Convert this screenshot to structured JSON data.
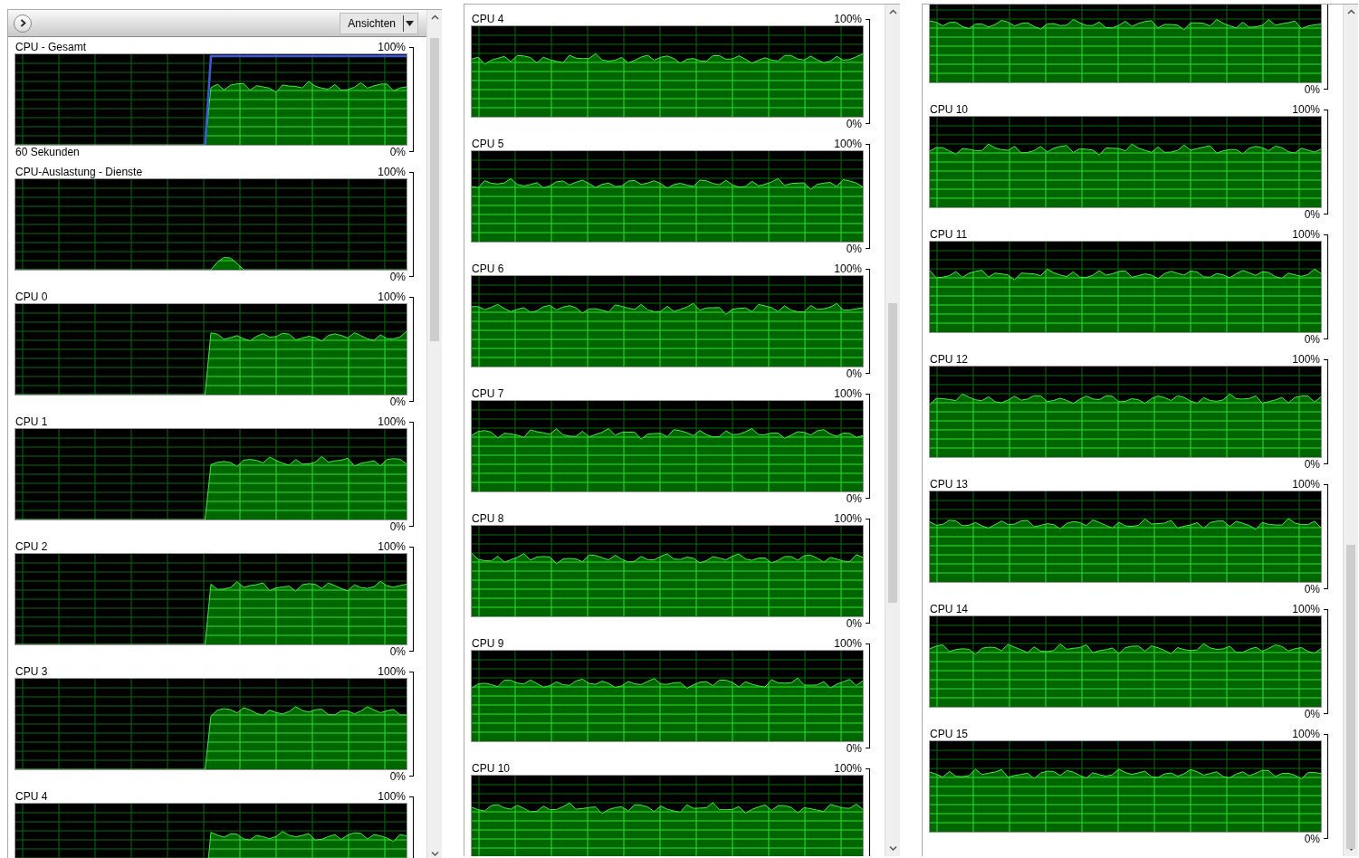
{
  "panels": [
    {
      "header": {
        "views_button": "Ansichten"
      },
      "graphs": [
        {
          "kind": "total",
          "title": "CPU - Gesamt",
          "max_label": "100%",
          "min_label": "0%",
          "time_span": "60 Sekunden"
        },
        {
          "kind": "services",
          "title": "CPU-Auslastung - Dienste",
          "max_label": "100%",
          "min_label": "0%"
        },
        {
          "kind": "ramp",
          "title": "CPU 0",
          "max_label": "100%",
          "min_label": "0%"
        },
        {
          "kind": "ramp",
          "title": "CPU 1",
          "max_label": "100%",
          "min_label": "0%"
        },
        {
          "kind": "ramp",
          "title": "CPU 2",
          "max_label": "100%",
          "min_label": "0%"
        },
        {
          "kind": "ramp",
          "title": "CPU 3",
          "max_label": "100%",
          "min_label": "0%"
        },
        {
          "kind": "ramp",
          "title": "CPU 4",
          "max_label": "100%"
        }
      ]
    },
    {
      "graphs": [
        {
          "kind": "steady",
          "title": "CPU 4",
          "max_label": "100%",
          "min_label": "0%"
        },
        {
          "kind": "steady",
          "title": "CPU 5",
          "max_label": "100%",
          "min_label": "0%"
        },
        {
          "kind": "steady",
          "title": "CPU 6",
          "max_label": "100%",
          "min_label": "0%"
        },
        {
          "kind": "steady",
          "title": "CPU 7",
          "max_label": "100%",
          "min_label": "0%"
        },
        {
          "kind": "steady",
          "title": "CPU 8",
          "max_label": "100%",
          "min_label": "0%"
        },
        {
          "kind": "steady",
          "title": "CPU 9",
          "max_label": "100%",
          "min_label": "0%"
        },
        {
          "kind": "steady",
          "title": "CPU 10",
          "max_label": "100%"
        }
      ]
    },
    {
      "graphs": [
        {
          "kind": "steady",
          "min_label": "0%"
        },
        {
          "kind": "steady",
          "title": "CPU 10",
          "max_label": "100%",
          "min_label": "0%"
        },
        {
          "kind": "steady",
          "title": "CPU 11",
          "max_label": "100%",
          "min_label": "0%"
        },
        {
          "kind": "steady",
          "title": "CPU 12",
          "max_label": "100%",
          "min_label": "0%"
        },
        {
          "kind": "steady",
          "title": "CPU 13",
          "max_label": "100%",
          "min_label": "0%"
        },
        {
          "kind": "steady",
          "title": "CPU 14",
          "max_label": "100%",
          "min_label": "0%"
        },
        {
          "kind": "steady",
          "title": "CPU 15",
          "max_label": "100%",
          "min_label": "0%"
        }
      ]
    }
  ]
}
